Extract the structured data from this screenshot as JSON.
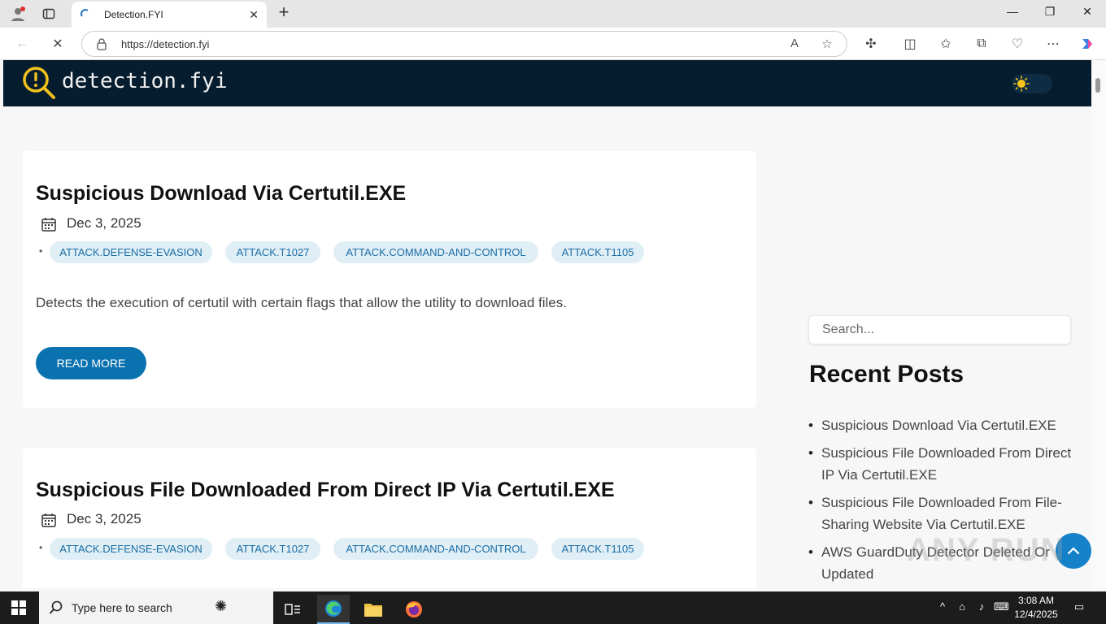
{
  "browser": {
    "tab_title": "Detection.FYI",
    "url": "https://detection.fyi"
  },
  "site": {
    "logo_text": "detection.fyi"
  },
  "posts": [
    {
      "title": "Suspicious Download Via Certutil.EXE",
      "date": "Dec 3, 2025",
      "tags": [
        "ATTACK.DEFENSE-EVASION",
        "ATTACK.T1027",
        "ATTACK.COMMAND-AND-CONTROL",
        "ATTACK.T1105"
      ],
      "excerpt": "Detects the execution of certutil with certain flags that allow the utility to download files.",
      "read_more": "READ MORE"
    },
    {
      "title": "Suspicious File Downloaded From Direct IP Via Certutil.EXE",
      "date": "Dec 3, 2025",
      "tags": [
        "ATTACK.DEFENSE-EVASION",
        "ATTACK.T1027",
        "ATTACK.COMMAND-AND-CONTROL",
        "ATTACK.T1105"
      ]
    }
  ],
  "sidebar": {
    "search_placeholder": "Search...",
    "recent_title": "Recent Posts",
    "recent_posts": [
      "Suspicious Download Via Certutil.EXE",
      "Suspicious File Downloaded From Direct IP Via Certutil.EXE",
      "Suspicious File Downloaded From File-Sharing Website Via Certutil.EXE",
      "AWS GuardDuty Detector Deleted Or Updated"
    ]
  },
  "watermark": "ANY RUN",
  "taskbar": {
    "search_text": "Type here to search",
    "time": "3:08 AM",
    "date": "12/4/2025"
  },
  "colors": {
    "header_bg": "#061d2f",
    "accent": "#0b72b0",
    "tag_bg": "#e0eef6",
    "tag_text": "#1a6ea5"
  }
}
